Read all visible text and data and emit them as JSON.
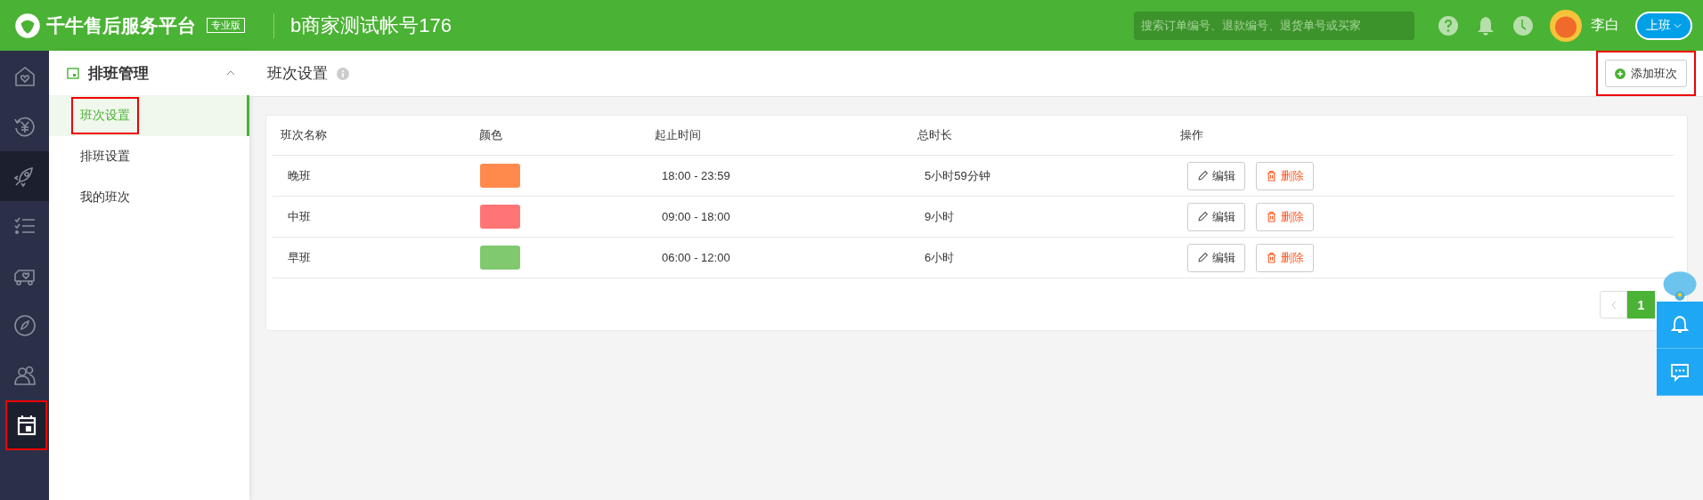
{
  "header": {
    "logo": "千牛售后服务平台",
    "edition": "专业版",
    "account": "b商家测试帐号176",
    "search": {
      "placeholder": "搜索订单编号、退款编号、退货单号或买家"
    },
    "user": "李白",
    "status_button": "上班"
  },
  "rail": [
    {
      "kind": "home",
      "selected": false,
      "highlighted": false
    },
    {
      "kind": "refund",
      "selected": false,
      "highlighted": false
    },
    {
      "kind": "rocket",
      "selected": true,
      "highlighted": false
    },
    {
      "kind": "checklist",
      "selected": false,
      "highlighted": false
    },
    {
      "kind": "truck",
      "selected": false,
      "highlighted": false
    },
    {
      "kind": "compass",
      "selected": false,
      "highlighted": false
    },
    {
      "kind": "people",
      "selected": false,
      "highlighted": false
    },
    {
      "kind": "calendar",
      "selected": true,
      "highlighted": true
    }
  ],
  "submenu": {
    "title": "排班管理",
    "expanded": true,
    "items": [
      {
        "label": "班次设置",
        "selected": true,
        "highlighted": true
      },
      {
        "label": "排班设置",
        "selected": false,
        "highlighted": false
      },
      {
        "label": "我的班次",
        "selected": false,
        "highlighted": false
      }
    ]
  },
  "page": {
    "title": "班次设置",
    "add_button": {
      "label": "添加班次",
      "highlighted": true
    }
  },
  "table": {
    "columns": [
      "班次名称",
      "颜色",
      "起止时间",
      "总时长",
      "操作"
    ],
    "rows": [
      {
        "name": "晚班",
        "color": "#ff8a4c",
        "time": "18:00 - 23:59",
        "duration": "5小时59分钟",
        "actions": [
          "编辑",
          "删除"
        ]
      },
      {
        "name": "中班",
        "color": "#ff7575",
        "time": "09:00 - 18:00",
        "duration": "9小时",
        "actions": [
          "编辑",
          "删除"
        ]
      },
      {
        "name": "早班",
        "color": "#80c96f",
        "time": "06:00 - 12:00",
        "duration": "6小时",
        "actions": [
          "编辑",
          "删除"
        ]
      }
    ]
  },
  "pagination": {
    "pages": [
      {
        "label": "1",
        "selected": true
      }
    ]
  }
}
